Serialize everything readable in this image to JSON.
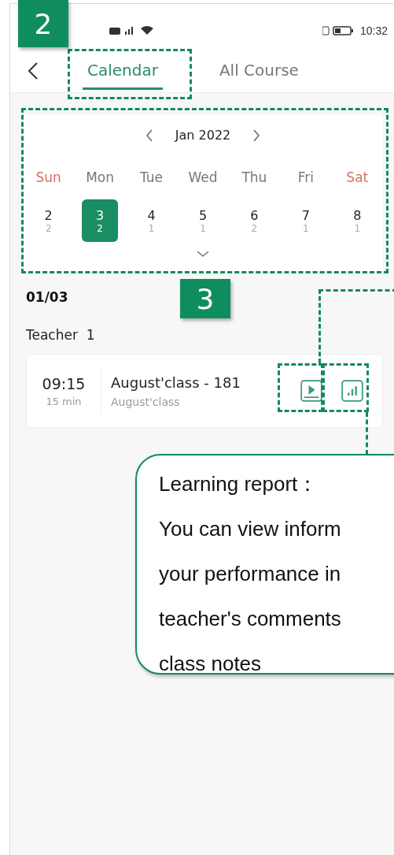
{
  "status_bar": {
    "time": "10:32"
  },
  "tabs": [
    {
      "label": "Calendar",
      "selected": true
    },
    {
      "label": "All Course",
      "selected": false
    }
  ],
  "calendar": {
    "month": "Jan 2022",
    "weekdays": [
      {
        "label": "Sun",
        "weekend": true
      },
      {
        "label": "Mon",
        "weekend": false
      },
      {
        "label": "Tue",
        "weekend": false
      },
      {
        "label": "Wed",
        "weekend": false
      },
      {
        "label": "Thu",
        "weekend": false
      },
      {
        "label": "Fri",
        "weekend": false
      },
      {
        "label": "Sat",
        "weekend": true
      }
    ],
    "days": [
      {
        "date": "2",
        "count": "2",
        "selected": false
      },
      {
        "date": "3",
        "count": "2",
        "selected": true
      },
      {
        "date": "4",
        "count": "1",
        "selected": false
      },
      {
        "date": "5",
        "count": "1",
        "selected": false
      },
      {
        "date": "6",
        "count": "2",
        "selected": false
      },
      {
        "date": "7",
        "count": "1",
        "selected": false
      },
      {
        "date": "8",
        "count": "1",
        "selected": false
      }
    ]
  },
  "schedule": {
    "date": "01/03",
    "teacher": "Teacher  1",
    "classes": [
      {
        "time": "09:15",
        "duration": "15 min",
        "title": "August'class - 181",
        "subtitle": "August'class"
      }
    ]
  },
  "annotations": {
    "badges": [
      "2",
      "3"
    ],
    "callout": {
      "title": "Learning report：",
      "lines": [
        "You can view inform",
        "your performance in",
        "teacher's comments",
        "class notes"
      ]
    }
  }
}
